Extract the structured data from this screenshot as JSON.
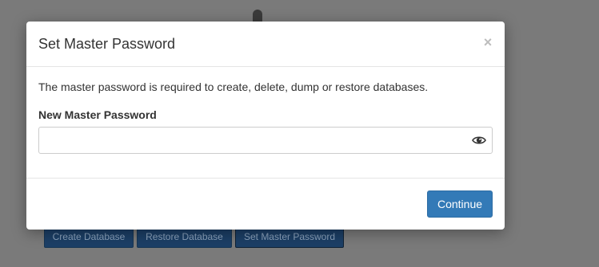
{
  "background": {
    "buttons": {
      "create_database": "Create Database",
      "restore_database": "Restore Database",
      "set_master_password": "Set Master Password"
    }
  },
  "modal": {
    "title": "Set Master Password",
    "close_glyph": "×",
    "description": "The master password is required to create, delete, dump or restore databases.",
    "field": {
      "label": "New Master Password",
      "value": "",
      "placeholder": "",
      "reveal_icon": "eye-icon"
    },
    "footer": {
      "continue_label": "Continue"
    }
  },
  "colors": {
    "primary": "#337ab7",
    "backdrop": "#7a7a7a",
    "background_button": "#1c3f66"
  }
}
